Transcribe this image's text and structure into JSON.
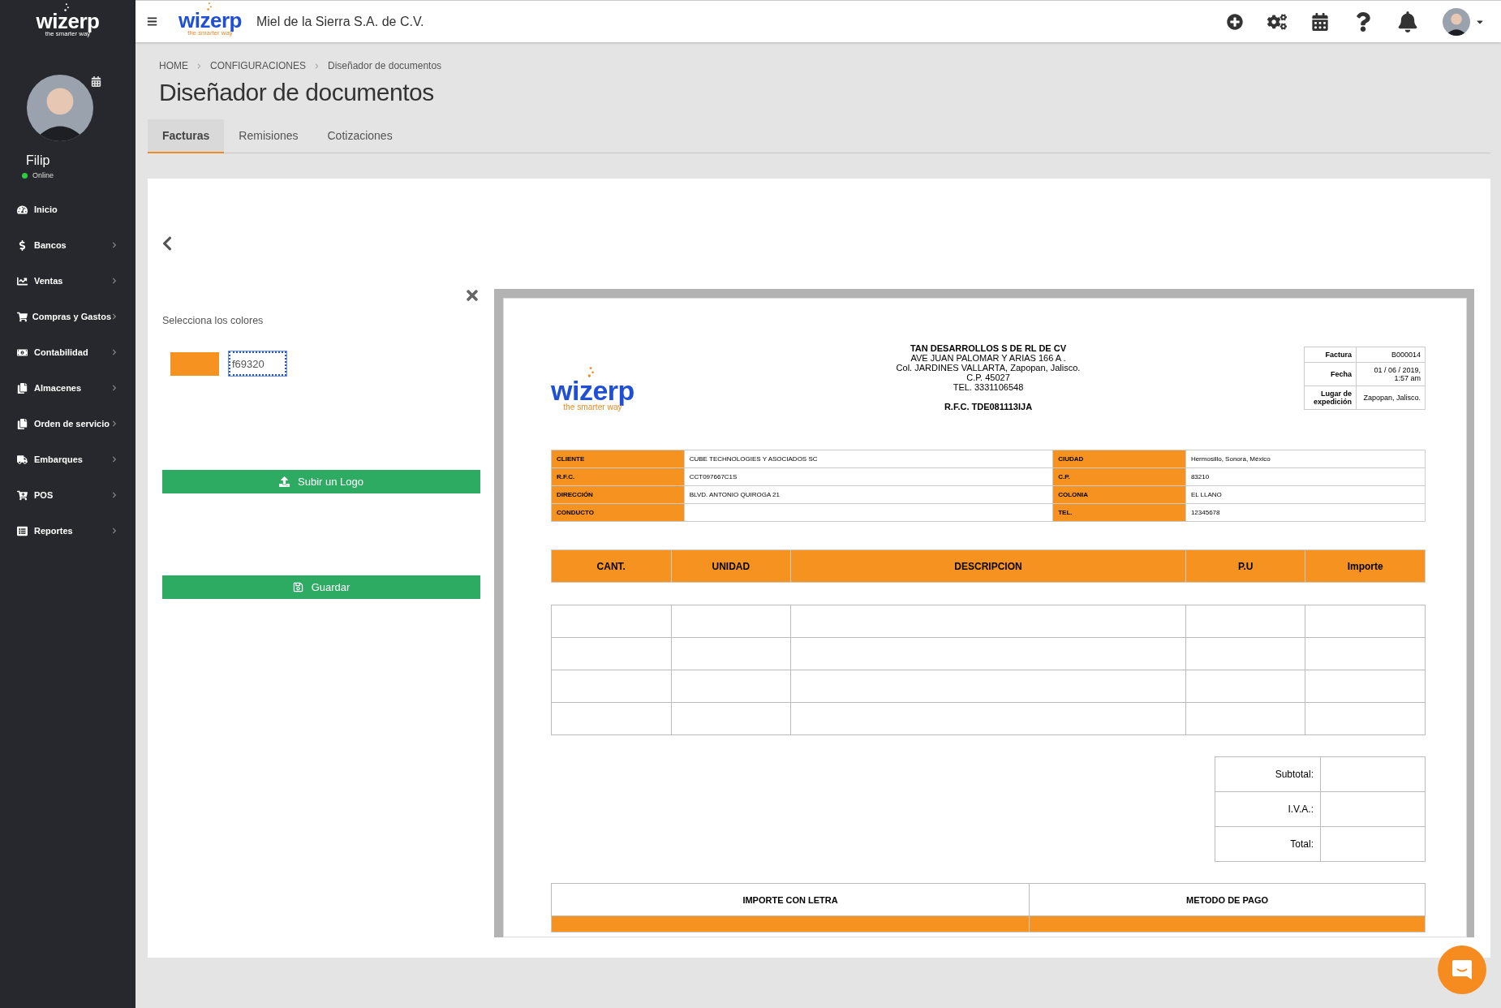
{
  "sidebar": {
    "logo": {
      "name": "wizerp",
      "tagline": "the smarter way"
    },
    "user": {
      "name": "Filip",
      "status": "Online",
      "online": true
    },
    "items": [
      {
        "label": "Inicio",
        "submenu": false
      },
      {
        "label": "Bancos",
        "submenu": true
      },
      {
        "label": "Ventas",
        "submenu": true
      },
      {
        "label": "Compras y Gastos",
        "submenu": true
      },
      {
        "label": "Contabilidad",
        "submenu": true
      },
      {
        "label": "Almacenes",
        "submenu": true
      },
      {
        "label": "Orden de servicio",
        "submenu": true
      },
      {
        "label": "Embarques",
        "submenu": true
      },
      {
        "label": "POS",
        "submenu": true
      },
      {
        "label": "Reportes",
        "submenu": true
      }
    ]
  },
  "topbar": {
    "logo": {
      "name": "wizerp",
      "tagline": "the smarter way"
    },
    "company": "Miel de la Sierra S.A. de C.V."
  },
  "breadcrumb": [
    "HOME",
    "CONFIGURACIONES",
    "Diseñador de documentos"
  ],
  "page_title": "Diseñador de documentos",
  "tabs": [
    {
      "label": "Facturas",
      "selected": true
    },
    {
      "label": "Remisiones",
      "selected": false
    },
    {
      "label": "Cotizaciones",
      "selected": false
    }
  ],
  "designer": {
    "colors_label": "Selecciona los colores",
    "color": "#f69320",
    "color_value": "f69320",
    "upload_button": "Subir un Logo",
    "save_button": "Guardar"
  },
  "document": {
    "logo": {
      "name": "wizerp",
      "tagline": "the smarter way"
    },
    "company": "TAN DESARROLLOS S DE RL DE CV",
    "address_lines": [
      "AVE JUAN PALOMAR Y ARIAS 166 A .",
      "Col. JARDINES VALLARTA, Zapopan, Jalisco.",
      "C.P. 45027",
      "TEL. 3331106548"
    ],
    "rfc": "R.F.C. TDE081113IJA",
    "meta": [
      {
        "label": "Factura",
        "value": "B000014"
      },
      {
        "label": "Fecha",
        "value": "01 / 06 / 2019, 1:57 am"
      },
      {
        "label": "Lugar de expedición",
        "value": "Zapopan, Jalisco."
      }
    ],
    "client_rows": [
      [
        {
          "label": "CLIENTE",
          "value": "CUBE TECHNOLOGIES Y ASOCIADOS SC"
        },
        {
          "label": "CIUDAD",
          "value": "Hermosillo, Sonora, México"
        }
      ],
      [
        {
          "label": "R.F.C.",
          "value": "CCT097667C1S"
        },
        {
          "label": "C.P.",
          "value": "83210"
        }
      ],
      [
        {
          "label": "DIRECCIÓN",
          "value": "BLVD. ANTONIO QUIROGA 21"
        },
        {
          "label": "COLONIA",
          "value": "EL LLANO"
        }
      ],
      [
        {
          "label": "CONDUCTO"
        },
        {
          "label": "TEL.",
          "value": "12345678"
        }
      ]
    ],
    "columns": [
      "CANT.",
      "UNIDAD",
      "DESCRIPCION",
      "P.U",
      "Importe"
    ],
    "totals": [
      "Subtotal:",
      "I.V.A.:",
      "Total:"
    ],
    "footer": [
      "IMPORTE CON LETRA",
      "METODO DE PAGO"
    ]
  }
}
